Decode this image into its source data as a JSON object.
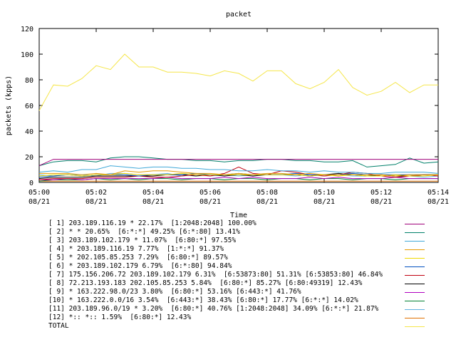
{
  "chart_data": {
    "type": "line",
    "title": "packet",
    "xlabel": "Time",
    "ylabel": "packets (kpps)",
    "ylim": [
      0,
      120
    ],
    "yticks": [
      "0",
      "20",
      "40",
      "60",
      "80",
      "100",
      "120"
    ],
    "xticks": [
      {
        "time": "05:00",
        "date": "08/21"
      },
      {
        "time": "05:02",
        "date": "08/21"
      },
      {
        "time": "05:04",
        "date": "08/21"
      },
      {
        "time": "05:06",
        "date": "08/21"
      },
      {
        "time": "05:08",
        "date": "08/21"
      },
      {
        "time": "05:10",
        "date": "08/21"
      },
      {
        "time": "05:12",
        "date": "08/21"
      },
      {
        "time": "05:14",
        "date": "08/21"
      }
    ],
    "x_minutes": [
      0,
      0.5,
      1,
      1.5,
      2,
      2.5,
      3,
      3.5,
      4,
      4.5,
      5,
      5.5,
      6,
      6.5,
      7,
      7.5,
      8,
      8.5,
      9,
      9.5,
      10,
      10.5,
      11,
      11.5,
      12,
      12.5,
      13,
      13.5,
      14
    ],
    "grid": false,
    "legend": "bottom",
    "series": [
      {
        "name": "[ 1] 203.189.116.19 * 22.17%  [1:2048:2048] 100.00%",
        "color": "#a0007a",
        "values": [
          13,
          18,
          18,
          18,
          18,
          18,
          18,
          18,
          18,
          18,
          18,
          18,
          18,
          18,
          18,
          18,
          18,
          18,
          18,
          18,
          18,
          18,
          18,
          18,
          18,
          18,
          18,
          18,
          18
        ]
      },
      {
        "name": "[ 2] * * 20.65%  [6:*:*] 49.25% [6:*:80] 13.41%",
        "color": "#00806a",
        "values": [
          13,
          16,
          17,
          17,
          16,
          19,
          20,
          20,
          19,
          18,
          18,
          17,
          17,
          16,
          17,
          17,
          18,
          18,
          17,
          17,
          16,
          16,
          17,
          12,
          13,
          14,
          19,
          15,
          16
        ]
      },
      {
        "name": "[ 3] 203.189.102.179 * 11.07%  [6:80:*] 97.55%",
        "color": "#40a8d8",
        "values": [
          8,
          9,
          8,
          10,
          10,
          13,
          12,
          11,
          12,
          12,
          11,
          11,
          10,
          10,
          9,
          9,
          10,
          9,
          9,
          8,
          9,
          8,
          8,
          7,
          7,
          8,
          8,
          8,
          7
        ]
      },
      {
        "name": "[ 4] * 203.189.116.19 7.77%  [1:*:*] 91.37%",
        "color": "#e69a00",
        "values": [
          7,
          7,
          7,
          6,
          7,
          6,
          9,
          8,
          9,
          9,
          8,
          7,
          7,
          6,
          7,
          6,
          7,
          7,
          6,
          7,
          6,
          6,
          6,
          6,
          6,
          5,
          6,
          6,
          6
        ]
      },
      {
        "name": "[ 5] * 202.105.85.253 7.29%  [6:80:*] 89.57%",
        "color": "#f0d800",
        "values": [
          5,
          6,
          6,
          5,
          6,
          6,
          7,
          6,
          6,
          6,
          7,
          6,
          6,
          6,
          6,
          6,
          6,
          6,
          6,
          5,
          6,
          5,
          6,
          5,
          5,
          6,
          5,
          5,
          6
        ]
      },
      {
        "name": "[ 6] * 203.189.102.179 6.79%  [6:*:80] 94.84%",
        "color": "#0050c0",
        "values": [
          4,
          5,
          6,
          5,
          6,
          6,
          6,
          5,
          6,
          6,
          6,
          7,
          6,
          6,
          7,
          6,
          6,
          6,
          7,
          6,
          6,
          6,
          7,
          6,
          6,
          6,
          6,
          6,
          6
        ]
      },
      {
        "name": "[ 7] 175.156.206.72 203.189.102.179 6.31%  [6:53873:80] 51.31% [6:53853:80] 46.84%",
        "color": "#c00010",
        "values": [
          2,
          3,
          3,
          3,
          4,
          4,
          4,
          5,
          4,
          4,
          5,
          6,
          5,
          7,
          12,
          7,
          6,
          9,
          8,
          6,
          5,
          6,
          8,
          7,
          5,
          4,
          5,
          6,
          5
        ]
      },
      {
        "name": "[ 8] 72.213.193.183 202.105.85.253 5.84%  [6:80:*] 85.27% [6:80:49319] 12.43%",
        "color": "#000000",
        "values": [
          3,
          4,
          4,
          4,
          5,
          5,
          5,
          5,
          5,
          6,
          6,
          5,
          6,
          5,
          6,
          5,
          6,
          6,
          6,
          5,
          6,
          7,
          6,
          5,
          6,
          5,
          5,
          6,
          6
        ]
      },
      {
        "name": "[ 9] * 163.222.98.0/23 3.80%  [6:80:*] 53.16% [6:443:*] 41.76%",
        "color": "#b000c0",
        "values": [
          2,
          2,
          3,
          2,
          3,
          3,
          3,
          3,
          3,
          4,
          3,
          3,
          3,
          4,
          3,
          4,
          3,
          3,
          3,
          4,
          3,
          4,
          3,
          3,
          3,
          4,
          3,
          3,
          3
        ]
      },
      {
        "name": "[10] * 163.222.0.0/16 3.54%  [6:443:*] 38.43% [6:80:*] 17.77% [6:*:*] 14.02%",
        "color": "#008030",
        "values": [
          1,
          2,
          2,
          2,
          3,
          2,
          3,
          2,
          3,
          3,
          2,
          3,
          3,
          2,
          3,
          3,
          2,
          3,
          3,
          2,
          3,
          3,
          2,
          3,
          3,
          2,
          3,
          3,
          3
        ]
      },
      {
        "name": "[11] 203.189.96.0/19 * 3.20%  [6:80:*] 40.76% [1:2048:2048] 34.09% [6:*:*] 21.87%",
        "color": "#60b0e0",
        "values": [
          6,
          5,
          6,
          6,
          5,
          7,
          7,
          6,
          6,
          7,
          5,
          6,
          5,
          6,
          5,
          6,
          6,
          6,
          5,
          6,
          5,
          6,
          5,
          5,
          6,
          5,
          5,
          4,
          5
        ]
      },
      {
        "name": "[12] *:: *:: 1.59%  [6:80:*] 12.43%",
        "color": "#e07000",
        "values": [
          1,
          1,
          1,
          1,
          1,
          1,
          1,
          1,
          1,
          1,
          1,
          1,
          1,
          1,
          1,
          1,
          1,
          1,
          1,
          1,
          1,
          1,
          1,
          1,
          1,
          1,
          1,
          1,
          1
        ]
      },
      {
        "name": "TOTAL",
        "color": "#f5e64a",
        "values": [
          56,
          76,
          75,
          81,
          91,
          88,
          100,
          90,
          90,
          86,
          86,
          85,
          83,
          87,
          85,
          79,
          87,
          87,
          77,
          73,
          78,
          88,
          74,
          68,
          71,
          78,
          70,
          76,
          76
        ]
      }
    ]
  }
}
